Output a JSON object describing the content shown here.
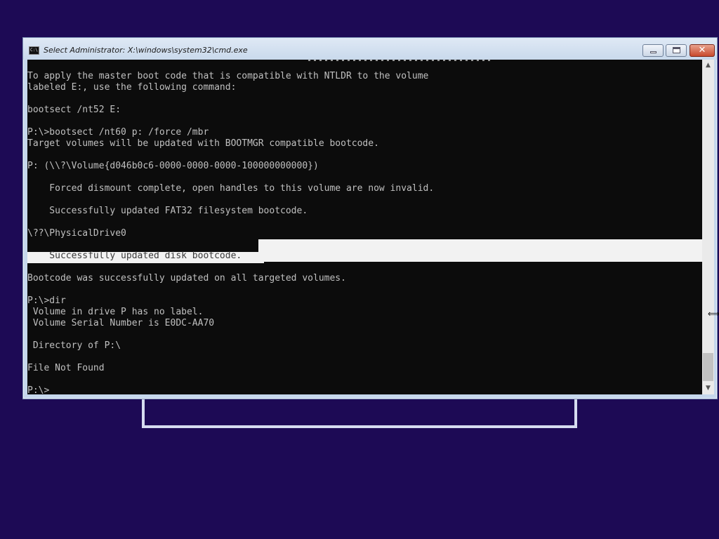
{
  "window": {
    "title": "Select Administrator: X:\\windows\\system32\\cmd.exe",
    "icon_label": "C:\\",
    "icon_name": "cmd-app-icon",
    "controls": {
      "minimize": "minimize-icon",
      "maximize": "maximize-icon",
      "close": "✕"
    }
  },
  "console": {
    "lines": [
      "To apply the master boot code that is compatible with NTLDR to the volume",
      "labeled E:, use the following command:",
      "",
      "bootsect /nt52 E:",
      "",
      "P:\\>bootsect /nt60 p: /force /mbr",
      "Target volumes will be updated with BOOTMGR compatible bootcode.",
      "",
      "P: (\\\\?\\Volume{d046b0c6-0000-0000-0000-100000000000})",
      "",
      "    Forced dismount complete, open handles to this volume are now invalid.",
      "",
      "    Successfully updated FAT32 filesystem bootcode.",
      "",
      "\\??\\PhysicalDrive0",
      "",
      "    Successfully updated disk bootcode.",
      "",
      "Bootcode was successfully updated on all targeted volumes.",
      "",
      "P:\\>dir",
      " Volume in drive P has no label.",
      " Volume Serial Number is E0DC-AA70",
      "",
      " Directory of P:\\",
      "",
      "File Not Found",
      "",
      "P:\\>"
    ],
    "selected_line_index": 16
  },
  "scrollbar": {
    "up_arrow": "▲",
    "down_arrow": "▼"
  },
  "colors": {
    "desktop": "#1d0a55",
    "console_bg": "#0c0c0c",
    "console_fg": "#c0c0c0",
    "selection": "#f2f2f2"
  }
}
